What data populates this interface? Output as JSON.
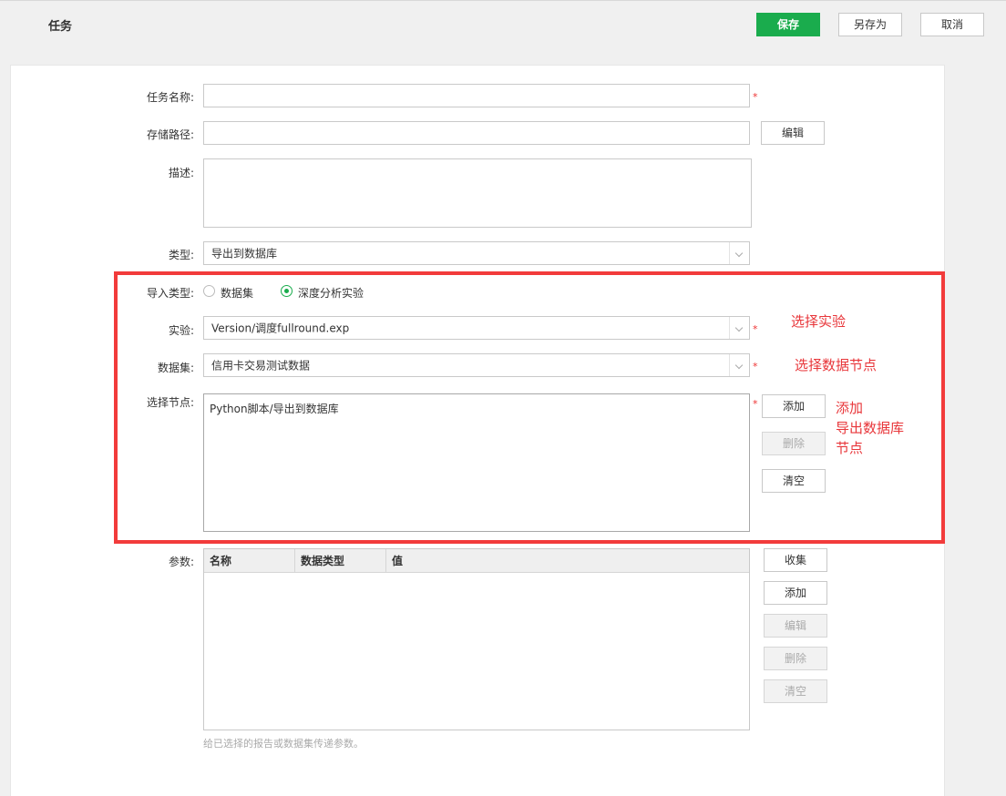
{
  "header": {
    "title": "任务",
    "save_label": "保存",
    "save_as_label": "另存为",
    "cancel_label": "取消"
  },
  "form": {
    "task_name": {
      "label": "任务名称:",
      "value": "",
      "required_mark": "*"
    },
    "storage_path": {
      "label": "存储路径:",
      "value": "",
      "edit_label": "编辑"
    },
    "description": {
      "label": "描述:",
      "value": ""
    },
    "type": {
      "label": "类型:",
      "value": "导出到数据库"
    },
    "import_type": {
      "label": "导入类型:",
      "options": [
        {
          "label": "数据集",
          "selected": false
        },
        {
          "label": "深度分析实验",
          "selected": true
        }
      ]
    },
    "experiment": {
      "label": "实验:",
      "value": "Version/调度fullround.exp",
      "required_mark": "*"
    },
    "dataset": {
      "label": "数据集:",
      "value": "信用卡交易测试数据",
      "required_mark": "*"
    },
    "select_node": {
      "label": "选择节点:",
      "required_mark": "*",
      "items": [
        "Python脚本/导出到数据库"
      ],
      "add_label": "添加",
      "delete_label": "删除",
      "clear_label": "清空"
    },
    "params": {
      "label": "参数:",
      "columns": [
        "名称",
        "数据类型",
        "值"
      ],
      "rows": [],
      "collect_label": "收集",
      "add_label": "添加",
      "edit_label": "编辑",
      "delete_label": "删除",
      "clear_label": "清空",
      "hint": "给已选择的报告或数据集传递参数。"
    }
  },
  "annotations": {
    "experiment_note": "选择实验",
    "dataset_note": "选择数据节点",
    "node_note_line1": "添加",
    "node_note_line2": "导出数据库",
    "node_note_line3": "节点"
  },
  "colors": {
    "primary": "#1aac4d",
    "highlight": "#f23b3b",
    "required": "#ee3333"
  }
}
